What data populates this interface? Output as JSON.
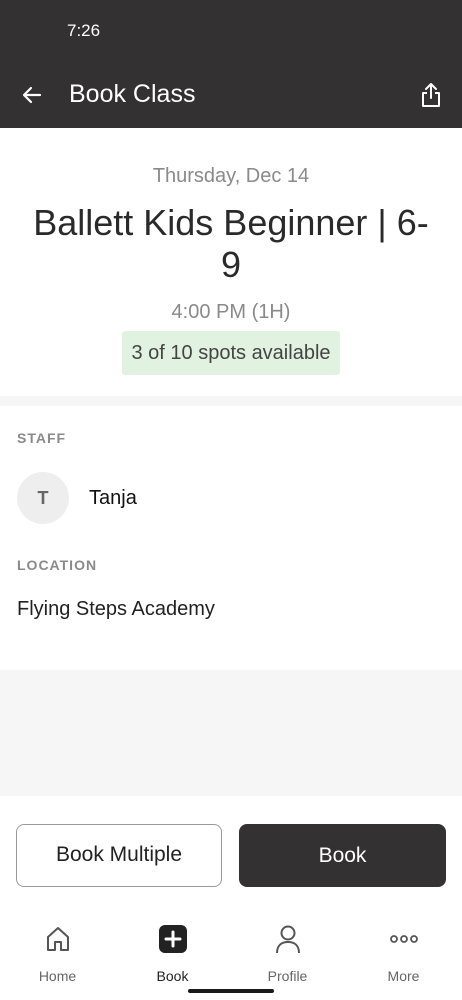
{
  "status_bar": {
    "time": "7:26"
  },
  "header": {
    "title": "Book Class",
    "back_icon": "arrow-left-icon",
    "share_icon": "share-icon"
  },
  "class_info": {
    "date": "Thursday, Dec 14",
    "name": "Ballett Kids Beginner | 6-9",
    "time": "4:00 PM (1H)",
    "spots": "3 of 10 spots available"
  },
  "staff": {
    "label": "STAFF",
    "initial": "T",
    "name": "Tanja"
  },
  "location": {
    "label": "LOCATION",
    "name": "Flying Steps Academy"
  },
  "actions": {
    "book_multiple": "Book Multiple",
    "book": "Book"
  },
  "tab_bar": {
    "tabs": [
      {
        "label": "Home",
        "icon": "home-icon",
        "active": false
      },
      {
        "label": "Book",
        "icon": "plus-square-icon",
        "active": true
      },
      {
        "label": "Profile",
        "icon": "person-icon",
        "active": false
      },
      {
        "label": "More",
        "icon": "more-dots-icon",
        "active": false
      }
    ]
  },
  "colors": {
    "header_bg": "#333132",
    "spots_badge_bg": "#e2f2e0",
    "primary_button": "#333132"
  }
}
